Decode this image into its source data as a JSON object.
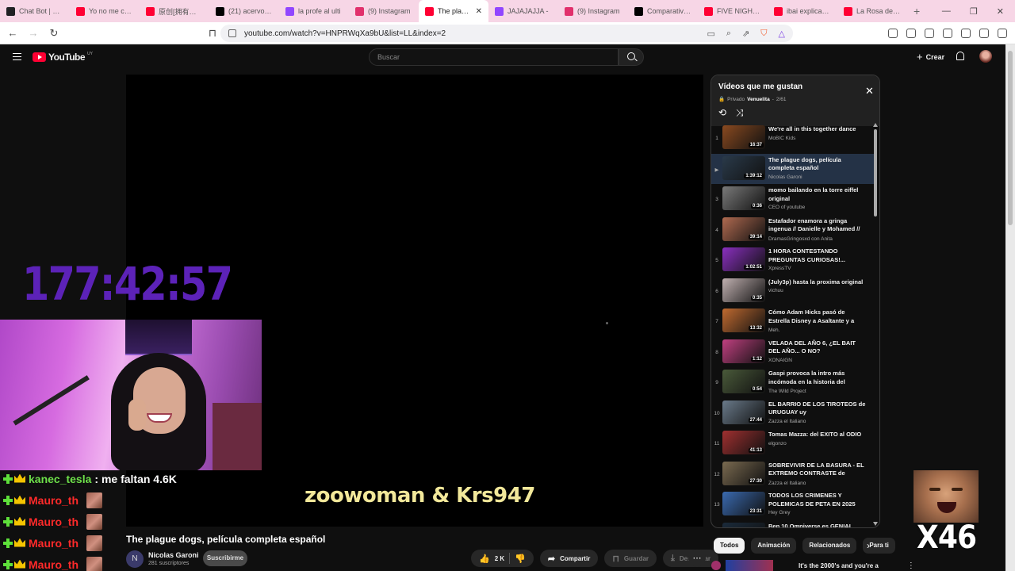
{
  "browser": {
    "tabs": [
      {
        "label": "Chat Bot | El m",
        "icon_color": "#202124",
        "icon": "chatbot-icon"
      },
      {
        "label": "Yo no me corro",
        "icon_color": "#ff0033",
        "icon": "youtube-icon"
      },
      {
        "label": "原创[拥有者]©",
        "icon_color": "#ff0033",
        "icon": "youtube-icon"
      },
      {
        "label": "(21) acervo dog",
        "icon_color": "#000000",
        "icon": "x-icon"
      },
      {
        "label": "la profe al ulti",
        "icon_color": "#9146ff",
        "icon": "twitch-icon"
      },
      {
        "label": "(9) Instagram",
        "icon_color": "#e1306c",
        "icon": "instagram-icon"
      },
      {
        "label": "The plague",
        "icon_color": "#ff0033",
        "icon": "youtube-icon",
        "active": true
      },
      {
        "label": "JAJAJAJJA - ",
        "icon_color": "#9146ff",
        "icon": "twitch-icon"
      },
      {
        "label": "(9) Instagram",
        "icon_color": "#e1306c",
        "icon": "instagram-icon"
      },
      {
        "label": "Comparativa d",
        "icon_color": "#000000",
        "icon": "tiktok-icon"
      },
      {
        "label": "FIVE NIGHTS A",
        "icon_color": "#ff0033",
        "icon": "youtube-icon"
      },
      {
        "label": "ibai explicando",
        "icon_color": "#ff0033",
        "icon": "youtube-icon"
      },
      {
        "label": "La Rosa de Gu",
        "icon_color": "#ff0033",
        "icon": "youtube-icon"
      }
    ],
    "url": "youtube.com/watch?v=HNPRWqXa9bU&list=LL&index=2"
  },
  "youtube": {
    "logo_text": "YouTube",
    "logo_country": "UY",
    "search_placeholder": "Buscar",
    "create_label": "Crear"
  },
  "stream": {
    "timer": "177:42:57",
    "names_overlay": "zoowoman & Krs947",
    "multiplier": "X46",
    "chat": [
      {
        "user": "kanec_tesla",
        "message": ": me faltan 4.6K",
        "name_color": "green"
      },
      {
        "user": "Mauro_th",
        "message": "",
        "name_color": "red"
      },
      {
        "user": "Mauro_th",
        "message": "",
        "name_color": "red"
      },
      {
        "user": "Mauro_th",
        "message": "",
        "name_color": "red"
      },
      {
        "user": "Mauro_th",
        "message": "",
        "name_color": "red"
      }
    ]
  },
  "video": {
    "title": "The plague dogs, película completa español",
    "channel": "Nicolas Garoni",
    "channel_initial": "N",
    "subscribers": "281 suscriptores",
    "subscribe_label": "Suscribirme",
    "likes": "2 K",
    "share_label": "Compartir",
    "save_label": "Guardar",
    "download_label": "Descargar"
  },
  "playlist": {
    "title": "Vídeos que me gustan",
    "privacy": "Privado",
    "owner": "Venuelita",
    "position": "2/61",
    "items": [
      {
        "index": "1",
        "title": "We're all in this together dance",
        "channel": "MoBIC Kids",
        "duration": "16:37",
        "thumb": "#8a4a20"
      },
      {
        "index": "",
        "title": "The plague dogs, película completa español",
        "channel": "Nicolas Garoni",
        "duration": "1:39:12",
        "thumb": "#2a3a4a",
        "current": true
      },
      {
        "index": "3",
        "title": "momo bailando en la torre eiffel original",
        "channel": "CEO of youtube",
        "duration": "0:36",
        "thumb": "#7a7a7a"
      },
      {
        "index": "4",
        "title": "Estafador enamora a gringa ingenua // Danielle y Mohamed // Todo en 9...",
        "channel": "DramasGringosxd con Anita",
        "duration": "39:14",
        "thumb": "#b06a50"
      },
      {
        "index": "5",
        "title": "1 HORA CONTESTANDO PREGUNTAS CURIOSAS!...",
        "channel": "XpressTV",
        "duration": "1:02:51",
        "thumb": "#8a30c0"
      },
      {
        "index": "6",
        "title": "(July3p) hasta la proxima original",
        "channel": "vichuu",
        "duration": "0:35",
        "thumb": "#c0b0b0"
      },
      {
        "index": "7",
        "title": "Cómo Adam Hicks pasó de Estrella Disney a Asaltante y a ser...",
        "channel": "Meh.",
        "duration": "13:32",
        "thumb": "#c06a30"
      },
      {
        "index": "8",
        "title": "VELADA DEL AÑO 6, ¿EL BAIT DEL AÑO... O NO?",
        "channel": "XONAIGN",
        "duration": "1:12",
        "thumb": "#c04080"
      },
      {
        "index": "9",
        "title": "Gaspi provoca la intro más incómoda en la historia del podcast",
        "channel": "The Wild Project",
        "duration": "0:54",
        "thumb": "#4a5a3a"
      },
      {
        "index": "10",
        "title": "EL BARRIO DE LOS TIROTEOS de URUGUAY uy",
        "channel": "Zazza el Italiano",
        "duration": "27:44",
        "thumb": "#6a7a8a"
      },
      {
        "index": "11",
        "title": "Tomas Mazza: del EXITO al ODIO",
        "channel": "elgonzo",
        "duration": "41:13",
        "thumb": "#a03030"
      },
      {
        "index": "12",
        "title": "SOBREVIVIR DE LA BASURA - EL EXTREMO CONTRASTE de URUGU...",
        "channel": "Zazza el Italiano",
        "duration": "27:30",
        "thumb": "#7a6a50"
      },
      {
        "index": "13",
        "title": "TODOS LOS CRIMENES Y POLEMICAS DE PETA EN 2025",
        "channel": "Hey Grey",
        "duration": "23:31",
        "thumb": "#3a6ab0"
      },
      {
        "index": "",
        "title": "Ben 10 Omniverse es GENIAL (casi",
        "channel": "",
        "duration": "",
        "thumb": "#1a2a3a"
      }
    ]
  },
  "chips": [
    "Todos",
    "Animación",
    "Relacionados",
    "Para ti"
  ],
  "next_recommendation": "It's the 2000's and you're a"
}
